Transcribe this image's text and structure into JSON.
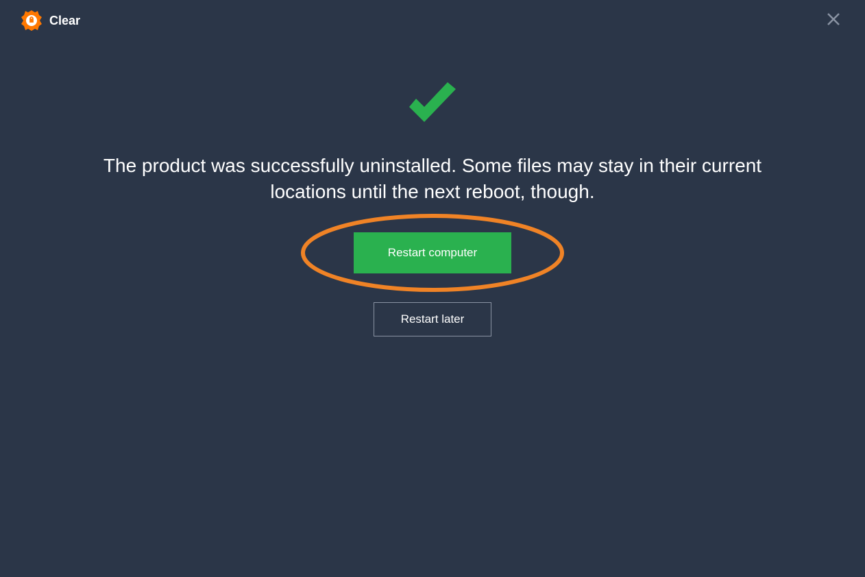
{
  "header": {
    "title": "Clear"
  },
  "main": {
    "message": "The product was successfully uninstalled. Some files may stay in their current locations until the next reboot, though.",
    "primary_button_label": "Restart computer",
    "secondary_button_label": "Restart later"
  },
  "colors": {
    "accent_orange": "#ff7800",
    "success_green": "#2ab14f",
    "highlight_orange": "#f08326"
  }
}
